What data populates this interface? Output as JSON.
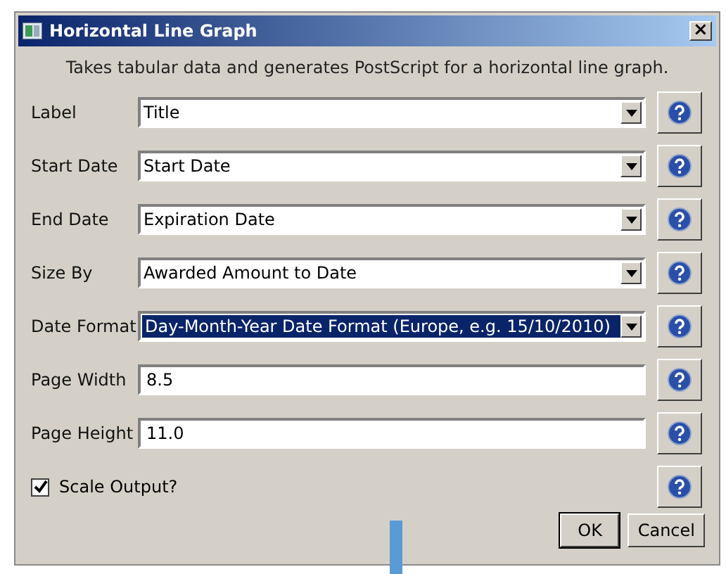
{
  "window": {
    "title": "Horizontal Line Graph",
    "close": "×"
  },
  "description": "Takes tabular data and generates PostScript for a horizontal line graph.",
  "fields": [
    {
      "kind": "combo",
      "label": "Label",
      "value": "Title",
      "highlighted": false
    },
    {
      "kind": "combo",
      "label": "Start Date",
      "value": "Start Date",
      "highlighted": false
    },
    {
      "kind": "combo",
      "label": "End Date",
      "value": "Expiration Date",
      "highlighted": false
    },
    {
      "kind": "combo",
      "label": "Size By",
      "value": "Awarded Amount to Date",
      "highlighted": false
    },
    {
      "kind": "combo",
      "label": "Date Format",
      "value": "Day-Month-Year Date Format (Europe, e.g. 15/10/2010)",
      "highlighted": true
    },
    {
      "kind": "text",
      "label": "Page Width",
      "value": "8.5"
    },
    {
      "kind": "text",
      "label": "Page Height",
      "value": "11.0"
    },
    {
      "kind": "checkbox",
      "label": "Scale Output?",
      "checked": true
    }
  ],
  "buttons": [
    "OK",
    "Cancel"
  ]
}
